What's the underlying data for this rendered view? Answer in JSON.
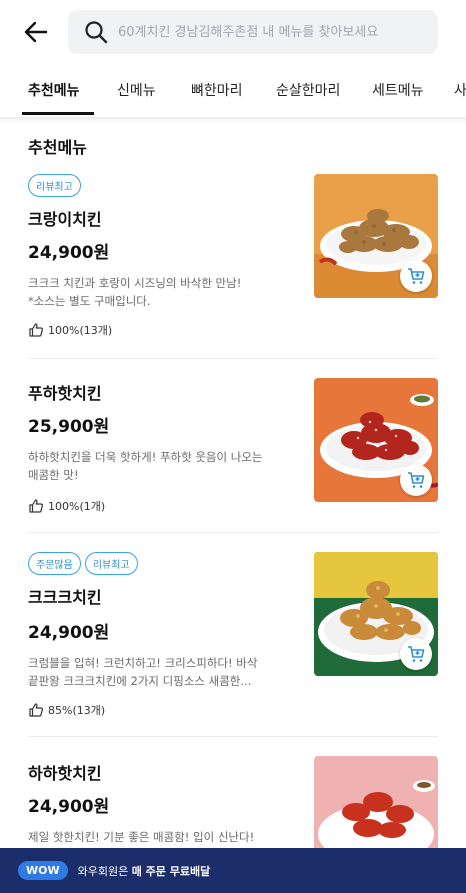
{
  "search": {
    "placeholder": "60계치킨 경남김해주촌점 내 메뉴를 찾아보세요"
  },
  "tabs": [
    "추천메뉴",
    "신메뉴",
    "뼈한마리",
    "순살한마리",
    "세트메뉴",
    "사"
  ],
  "section_title": "추천메뉴",
  "items": [
    {
      "badges": [
        "리뷰최고"
      ],
      "name": "크랑이치킨",
      "price": "24,900원",
      "desc": [
        "크크크 치킨과 호랑이 시즈닝의 바삭한 만남!",
        "*소스는 별도 구매입니다."
      ],
      "rating": "100%(13개)"
    },
    {
      "badges": [],
      "name": "푸하핫치킨",
      "price": "25,900원",
      "desc": [
        "하하핫치킨을 더욱 핫하게! 푸하핫 웃음이 나오는",
        "매콤한 맛!"
      ],
      "rating": "100%(1개)"
    },
    {
      "badges": [
        "주문많음",
        "리뷰최고"
      ],
      "name": "크크크치킨",
      "price": "24,900원",
      "desc": [
        "크럼블을 입혀! 크런치하고! 크리스피하다! 바삭",
        "끝판왕 크크크치킨에 2가지 디핑소스 새콤한..."
      ],
      "rating": "85%(13개)"
    },
    {
      "badges": [],
      "name": "하하핫치킨",
      "price": "24,900원",
      "desc": [
        "제일 핫한치킨! 기분 좋은 매콤함! 입이 신난다!"
      ],
      "rating": ""
    }
  ],
  "banner": {
    "badge": "WOW",
    "text_prefix": "와우회원은 ",
    "text_bold": "매 주문 무료배달"
  },
  "colors": {
    "accent": "#2f8fd0",
    "banner_bg": "#1b2d6b",
    "wow_badge": "#2f7ae5"
  },
  "icons": {
    "back": "arrow-left-icon",
    "search": "search-icon",
    "cart": "cart-add-icon",
    "thumb": "thumbs-up-icon"
  }
}
